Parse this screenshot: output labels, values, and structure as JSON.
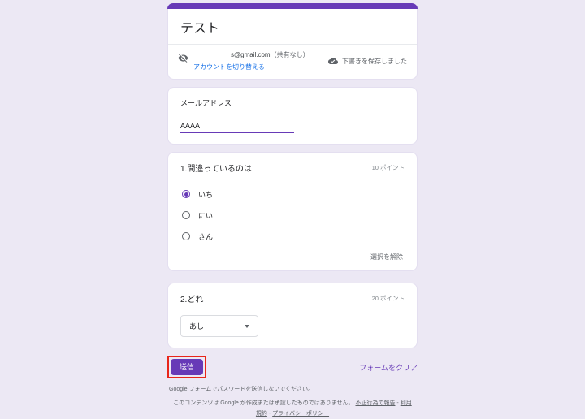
{
  "theme": {
    "accent_purple": "#673ab7",
    "page_background": "#ece8f4",
    "link_blue": "#1a73e8",
    "annotation_red": "#e8261a"
  },
  "icons": {
    "visibility_off": "visibility-off-icon",
    "cloud_done": "cloud-done-icon",
    "dropdown_arrow": "chevron-down-icon"
  },
  "form": {
    "title": "テスト",
    "account": {
      "email": "s@gmail.com",
      "shared_status": "（共有なし）",
      "switch_account": "アカウントを切り替える",
      "draft_saved": "下書きを保存しました"
    },
    "email_field": {
      "label": "メールアドレス",
      "value": "AAAA"
    },
    "questions": [
      {
        "title": "1.間違っているのは",
        "points": "10 ポイント",
        "type": "radio",
        "options": [
          "いち",
          "にい",
          "さん"
        ],
        "selected": "いち",
        "clear_label": "選択を解除"
      },
      {
        "title": "2.どれ",
        "points": "20 ポイント",
        "type": "dropdown",
        "selected": "あし"
      }
    ],
    "submit_label": "送信",
    "clear_form_label": "フォームをクリア"
  },
  "footer": {
    "password_warning": "Google フォームでパスワードを送信しないでください。",
    "disclaimer": "このコンテンツは Google が作成または承認したものではありません。",
    "links": [
      "不正行為の報告",
      "利用規約",
      "プライバシーポリシー"
    ],
    "separator": " - "
  }
}
